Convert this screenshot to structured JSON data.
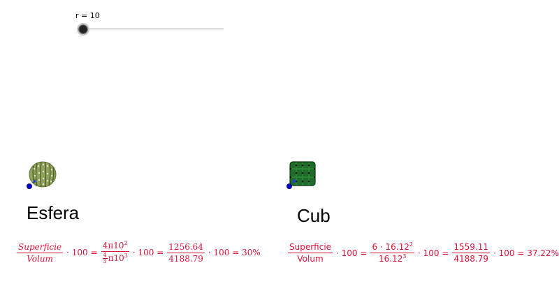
{
  "slider": {
    "label": "r = 10",
    "value": 10
  },
  "esfera": {
    "name": "Esfera",
    "icon": "round-cactus-icon",
    "formula": {
      "num1": "Superficie",
      "den1": "Volum",
      "mul": "· 100 =",
      "num2_a": "4π10",
      "num2_exp": "2",
      "den2_frac_n": "4",
      "den2_frac_d": "3",
      "den2_a": "π10",
      "den2_exp": "3",
      "mul2": "· 100 =",
      "num3": "1256.64",
      "den3": "4188.79",
      "result": "· 100 = 30%"
    }
  },
  "cub": {
    "name": "Cub",
    "icon": "cube-cactus-icon",
    "formula": {
      "num1": "Superficie",
      "den1": "Volum",
      "mul": "· 100 =",
      "num2_a": "6 · 16.12",
      "num2_exp": "2",
      "den2_a": "16.12",
      "den2_exp": "3",
      "mul2": "· 100 =",
      "num3": "1559.11",
      "den3": "4188.79",
      "result": "· 100 = 37.22%"
    }
  },
  "colors": {
    "formula": "#e0123a",
    "point": "#0000cc",
    "slider_track": "#9a9a9a"
  }
}
